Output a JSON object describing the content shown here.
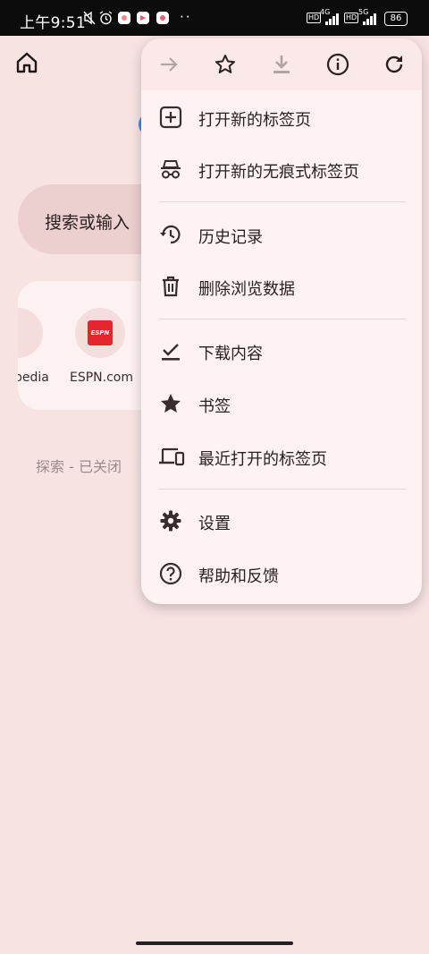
{
  "status_bar": {
    "time": "上午9:51",
    "network_1": "4G",
    "network_2": "5G",
    "battery": "86",
    "overflow_dots": "··"
  },
  "page": {
    "search_placeholder": "搜索或输入",
    "shortcuts": [
      {
        "label": "pedia",
        "icon": "wikipedia-icon"
      },
      {
        "label": "ESPN.com",
        "icon": "espn-icon",
        "logo_text": "ESPN"
      }
    ],
    "explore_status": "探索 - 已关闭"
  },
  "menu": {
    "toolbar": [
      {
        "name": "forward-icon",
        "enabled": false
      },
      {
        "name": "bookmark-star-icon",
        "enabled": true
      },
      {
        "name": "download-icon",
        "enabled": false
      },
      {
        "name": "info-icon",
        "enabled": true
      },
      {
        "name": "reload-icon",
        "enabled": true
      }
    ],
    "items": [
      {
        "label": "打开新的标签页",
        "icon": "new-tab-icon"
      },
      {
        "label": "打开新的无痕式标签页",
        "icon": "incognito-icon"
      },
      {
        "label": "历史记录",
        "icon": "history-icon"
      },
      {
        "label": "删除浏览数据",
        "icon": "trash-icon"
      },
      {
        "label": "下载内容",
        "icon": "downloads-check-icon"
      },
      {
        "label": "书签",
        "icon": "star-icon"
      },
      {
        "label": "最近打开的标签页",
        "icon": "devices-icon"
      },
      {
        "label": "设置",
        "icon": "gear-icon"
      },
      {
        "label": "帮助和反馈",
        "icon": "help-icon"
      }
    ]
  },
  "colors": {
    "page_background": "#f8e3e3",
    "menu_background": "#fef2f2",
    "icon_color": "#3a2c2c",
    "disabled_icon": "#b3a3a3",
    "espn_red": "#e4262c"
  }
}
